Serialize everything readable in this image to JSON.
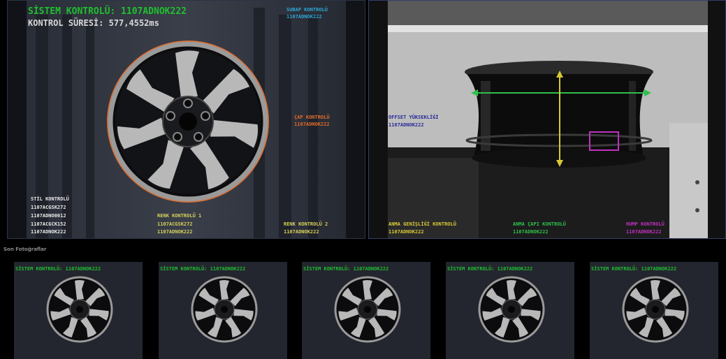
{
  "main_left": {
    "title": "SİSTEM KONTROLÜ: 1107ADNOK222",
    "duration": "KONTROL SÜRESİ: 577,4552ms",
    "subap": {
      "label": "SUBAP KONTROLÜ",
      "value": "1107ADNOK222"
    },
    "cap": {
      "label": "ÇAP KONTROLÜ",
      "value": "1107ADNOK222"
    },
    "stil": {
      "label": "STİL KONTROLÜ",
      "values": [
        "1107ACGSK272",
        "1107ADNO0012",
        "1107ACGCK152",
        "1107ADNOK222"
      ]
    },
    "renk1": {
      "label": "RENK KONTROLÜ 1",
      "values": [
        "1107ACGSK272",
        "1107ADNOK222"
      ]
    },
    "renk2": {
      "label": "RENK KONTROLÜ 2",
      "value": "1107ADNOK222"
    }
  },
  "main_right": {
    "offset": {
      "label": "OFFSET YÜKSEKLİĞİ",
      "value": "1107ADNOK222"
    },
    "anma_genislik": {
      "label": "ANMA GENİŞLİĞİ KONTROLÜ",
      "value": "1107ADNOK222"
    },
    "anma_cap": {
      "label": "ANMA ÇAPI KONTROLÜ",
      "value": "1107ADNOK222"
    },
    "hump": {
      "label": "HUMP KONTROLÜ",
      "value": "1107ADNOK222"
    }
  },
  "recent_label": "Son Fotoğraflar",
  "thumbnails": [
    {
      "title": "SİSTEM KONTROLÜ: 1107ADNOK222"
    },
    {
      "title": "SİSTEM KONTROLÜ: 1107ADNOK222"
    },
    {
      "title": "SİSTEM KONTROLÜ: 1107ADNOK222"
    },
    {
      "title": "SİSTEM KONTROLÜ: 1107ADNOK222"
    },
    {
      "title": "SİSTEM KONTROLÜ: 1107ADNOK222"
    }
  ],
  "colors": {
    "title_green": "#1fbf2f",
    "subap_cyan": "#2fa8d8",
    "cap_orange": "#e06a2a",
    "stil_white": "#e8e8e8",
    "renk_yellow": "#d8d05a",
    "offset_blue": "#2a2a9a",
    "anma_yellow": "#d8c838",
    "anma_cap_green": "#2fc04a",
    "hump_magenta": "#c030c0"
  }
}
